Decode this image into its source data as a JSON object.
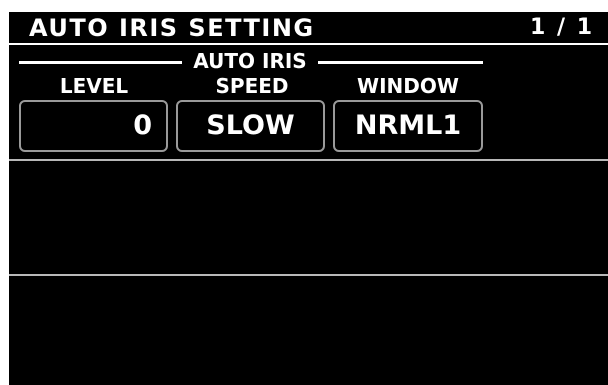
{
  "header": {
    "title": "AUTO IRIS SETTING",
    "page": "1 / 1"
  },
  "group": {
    "label": "AUTO IRIS"
  },
  "params": [
    {
      "label": "LEVEL",
      "value": "0"
    },
    {
      "label": "SPEED",
      "value": "SLOW"
    },
    {
      "label": "WINDOW",
      "value": "NRML1"
    }
  ]
}
